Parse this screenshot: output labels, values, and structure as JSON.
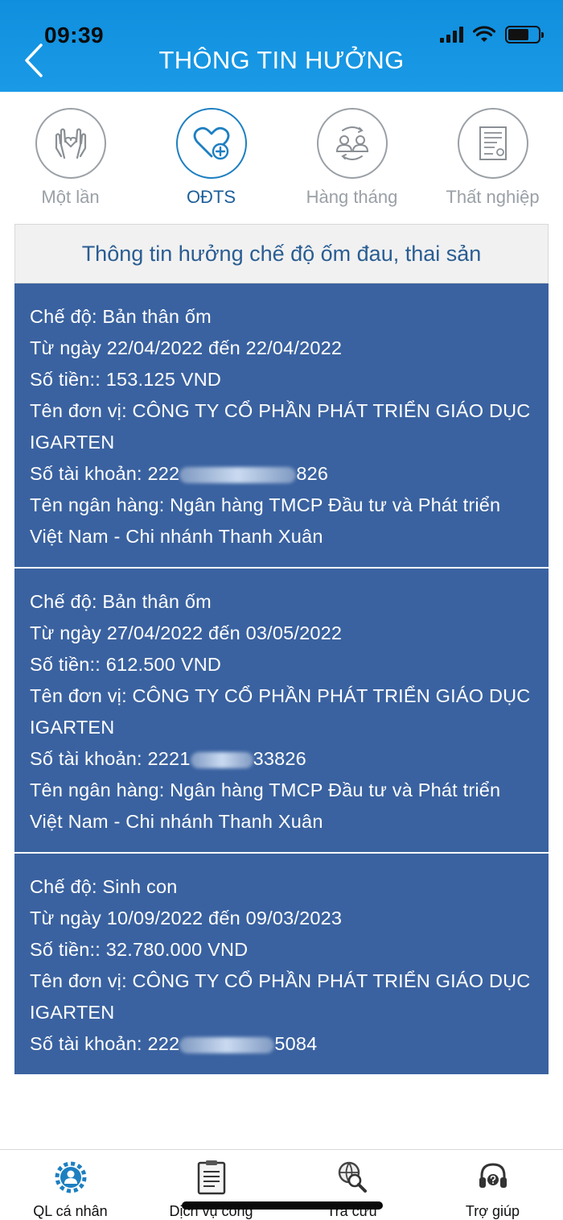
{
  "status_bar": {
    "time": "09:39"
  },
  "header": {
    "title": "THÔNG TIN HƯỞNG"
  },
  "tabs": [
    {
      "label": "Một lần",
      "icon": "hands-heart-icon",
      "active": false
    },
    {
      "label": "OĐTS",
      "icon": "heart-plus-icon",
      "active": true
    },
    {
      "label": "Hàng tháng",
      "icon": "people-exchange-icon",
      "active": false
    },
    {
      "label": "Thất nghiệp",
      "icon": "certificate-icon",
      "active": false
    }
  ],
  "section": {
    "title": "Thông tin hưởng chế độ ốm đau, thai sản"
  },
  "cards": [
    {
      "che_do": "Chế độ: Bản thân ốm",
      "tu_ngay": "Từ ngày 22/04/2022 đến 22/04/2022",
      "so_tien": "Số tiền:: 153.125 VND",
      "don_vi": "Tên đơn vị: CÔNG TY CỔ PHẦN PHÁT TRIỂN GIÁO DỤC IGARTEN",
      "tk_prefix": "Số tài khoản: 222",
      "tk_suffix": "826",
      "ngan_hang": "Tên ngân hàng: Ngân hàng TMCP Đầu tư và Phát triển Việt Nam - Chi nhánh Thanh Xuân"
    },
    {
      "che_do": "Chế độ: Bản thân ốm",
      "tu_ngay": "Từ ngày 27/04/2022 đến 03/05/2022",
      "so_tien": "Số tiền:: 612.500 VND",
      "don_vi": "Tên đơn vị: CÔNG TY CỔ PHẦN PHÁT TRIỂN GIÁO DỤC IGARTEN",
      "tk_prefix": "Số tài khoản: 2221",
      "tk_suffix": "33826",
      "ngan_hang": "Tên ngân hàng: Ngân hàng TMCP Đầu tư và Phát triển Việt Nam - Chi nhánh Thanh Xuân"
    },
    {
      "che_do": "Chế độ: Sinh con",
      "tu_ngay": "Từ ngày 10/09/2022 đến 09/03/2023",
      "so_tien": "Số tiền:: 32.780.000 VND",
      "don_vi": "Tên đơn vị: CÔNG TY CỔ PHẦN PHÁT TRIỂN GIÁO DỤC IGARTEN",
      "tk_prefix": "Số tài khoản: 222",
      "tk_suffix": "5084"
    }
  ],
  "bottom_nav": [
    {
      "label": "QL cá nhân",
      "icon": "user-gear-icon"
    },
    {
      "label": "Dịch vụ công",
      "icon": "document-list-icon"
    },
    {
      "label": "Tra cứu",
      "icon": "globe-search-icon"
    },
    {
      "label": "Trợ giúp",
      "icon": "headset-help-icon"
    }
  ],
  "colors": {
    "header_blue": "#1a9ae6",
    "card_blue": "#3a62a0",
    "active_blue": "#1d7fc1",
    "inactive_gray": "#9aa0a6"
  }
}
